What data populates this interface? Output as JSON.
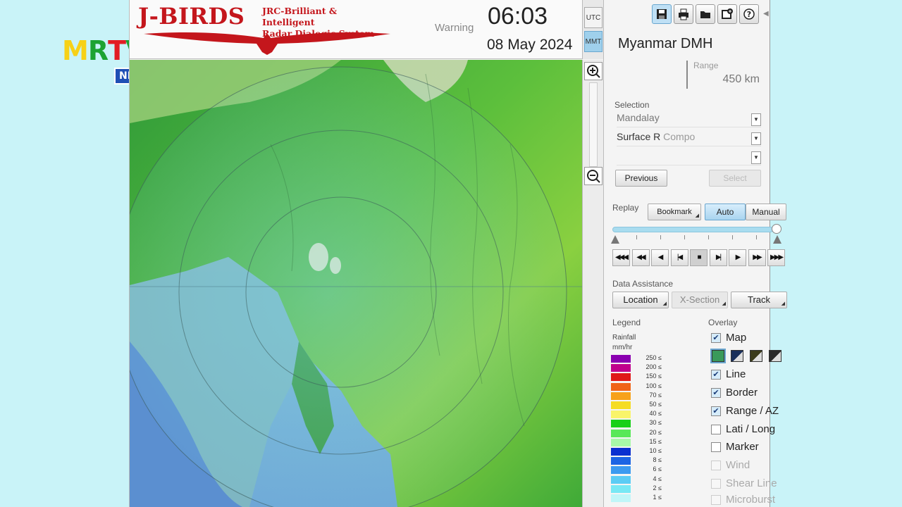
{
  "broadcast": {
    "logo_text": "MRTV",
    "logo_sub": "NEWS"
  },
  "app": {
    "logo_title": "J-BIRDS",
    "logo_subtitle_line1": "JRC-Brilliant & Intelligent",
    "logo_subtitle_line2": "Radar Dialogic System",
    "warning": "Warning",
    "time": "06:03",
    "date": "08 May 2024",
    "timezone": {
      "utc": "UTC",
      "mmt": "MMT",
      "selected": "MMT"
    }
  },
  "panel": {
    "site_name": "Myanmar DMH",
    "range_label": "Range",
    "range_value": "450 km",
    "selection_label": "Selection",
    "selection_1": "Mandalay",
    "selection_2_a": "Surface R",
    "selection_2_b": "Compo",
    "previous": "Previous",
    "select": "Select",
    "replay_label": "Replay",
    "bookmark": "Bookmark",
    "auto": "Auto",
    "manual": "Manual",
    "data_assistance_label": "Data Assistance",
    "location": "Location",
    "xsection": "X-Section",
    "track": "Track",
    "legend_label": "Legend",
    "legend_unit_1": "Rainfall",
    "legend_unit_2": "mm/hr",
    "overlay_label": "Overlay"
  },
  "playback": {
    "buttons": [
      {
        "icon": "first-icon",
        "glyph": "◀◀◀"
      },
      {
        "icon": "rewind-icon",
        "glyph": "◀◀"
      },
      {
        "icon": "step-back-icon",
        "glyph": "◀"
      },
      {
        "icon": "skip-start-icon",
        "glyph": "|◀"
      },
      {
        "icon": "stop-icon",
        "glyph": "■"
      },
      {
        "icon": "skip-end-icon",
        "glyph": "▶|"
      },
      {
        "icon": "play-icon",
        "glyph": "▶"
      },
      {
        "icon": "fast-forward-icon",
        "glyph": "▶▶"
      },
      {
        "icon": "last-icon",
        "glyph": "▶▶▶"
      }
    ],
    "slider_position": 1.0
  },
  "legend": [
    {
      "value": "250 ≤",
      "color": "#8a00b0"
    },
    {
      "value": "200 ≤",
      "color": "#c0008c"
    },
    {
      "value": "150 ≤",
      "color": "#e01818"
    },
    {
      "value": "100 ≤",
      "color": "#f06418"
    },
    {
      "value": "70 ≤",
      "color": "#f7a21a"
    },
    {
      "value": "50 ≤",
      "color": "#f5dc22"
    },
    {
      "value": "40 ≤",
      "color": "#f9f46a"
    },
    {
      "value": "30 ≤",
      "color": "#18d018"
    },
    {
      "value": "20 ≤",
      "color": "#58e858"
    },
    {
      "value": "15 ≤",
      "color": "#a8f8a8"
    },
    {
      "value": "10 ≤",
      "color": "#0a2fd0"
    },
    {
      "value": "8 ≤",
      "color": "#1c64e4"
    },
    {
      "value": "6 ≤",
      "color": "#3c9af0"
    },
    {
      "value": "4 ≤",
      "color": "#5cccf4"
    },
    {
      "value": "2 ≤",
      "color": "#78e8f4"
    },
    {
      "value": "1 ≤",
      "color": "#c0f6f8"
    }
  ],
  "overlay": [
    {
      "label": "Map",
      "checked": true,
      "disabled": false
    },
    {
      "label": "Line",
      "checked": true,
      "disabled": false
    },
    {
      "label": "Border",
      "checked": true,
      "disabled": false
    },
    {
      "label": "Range / AZ",
      "checked": true,
      "disabled": false
    },
    {
      "label": "Lati / Long",
      "checked": false,
      "disabled": false
    },
    {
      "label": "Marker",
      "checked": false,
      "disabled": false
    },
    {
      "label": "Wind",
      "checked": false,
      "disabled": true
    },
    {
      "label": "Shear Line",
      "checked": false,
      "disabled": true
    },
    {
      "label": "Microburst",
      "checked": false,
      "disabled": true
    }
  ],
  "map_styles": [
    {
      "name": "terrain-color",
      "color": "#3a9a5a",
      "selected": true
    },
    {
      "name": "terrain-dark-blue",
      "color": "#1a2f5a",
      "selected": false
    },
    {
      "name": "terrain-dark-olive",
      "color": "#3a3a1a",
      "selected": false
    },
    {
      "name": "terrain-dark-gray",
      "color": "#2a2a2a",
      "selected": false
    }
  ]
}
